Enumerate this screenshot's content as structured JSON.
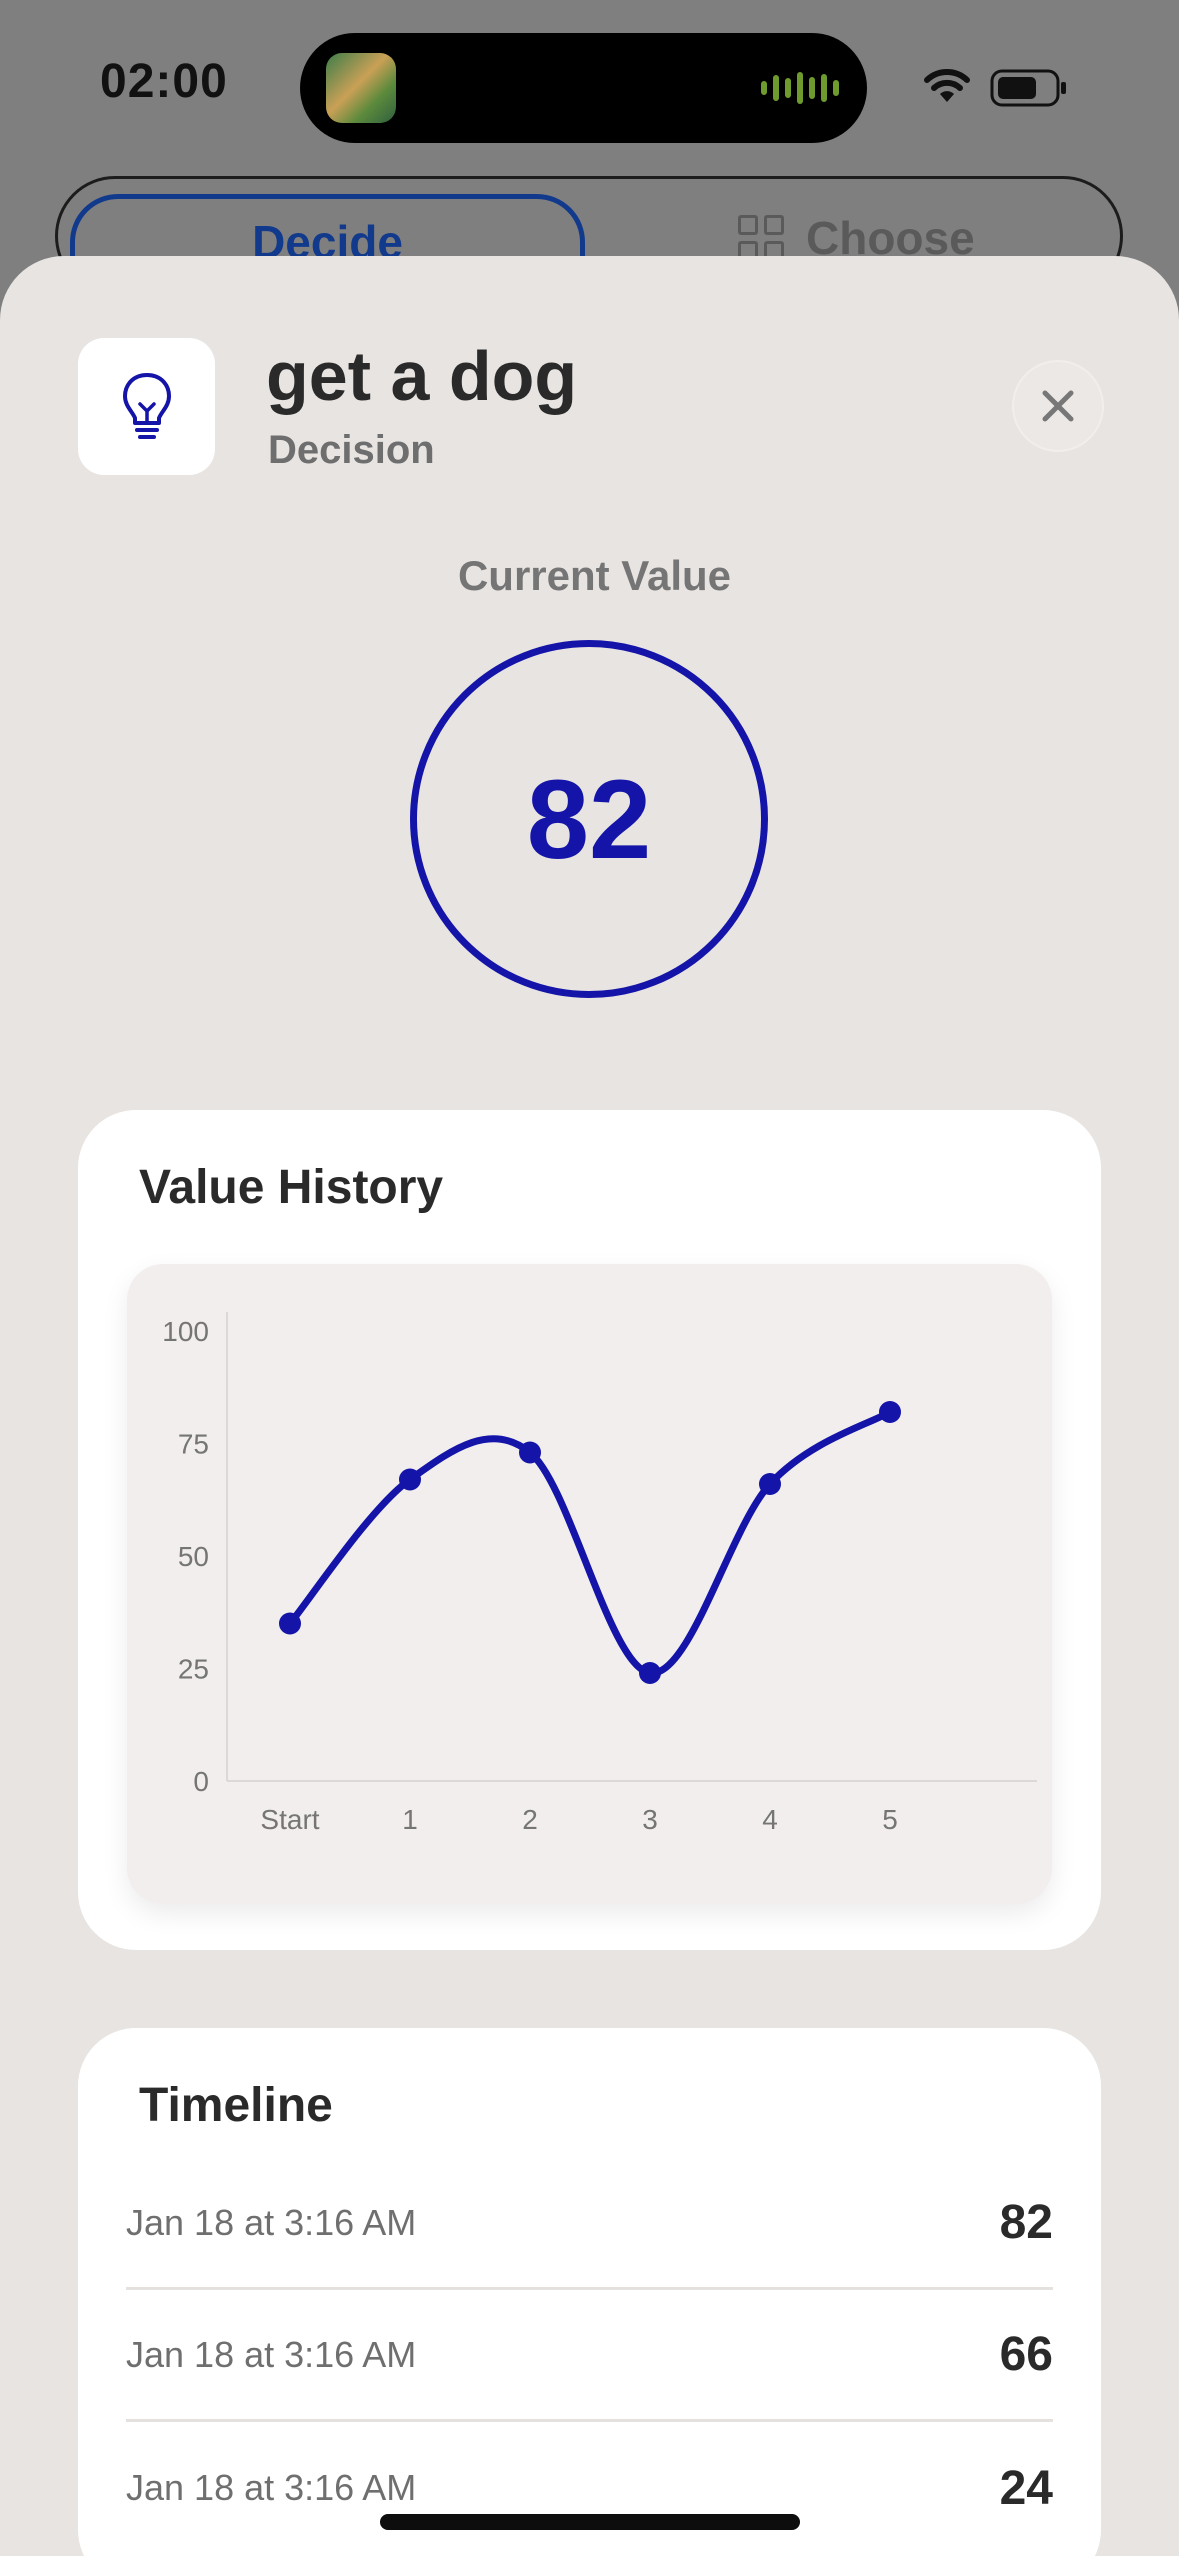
{
  "status_bar": {
    "time": "02:00",
    "wifi_icon": "wifi-icon",
    "battery_icon": "battery-icon",
    "now_playing_icon": "album-art-icon"
  },
  "background": {
    "segment_left_label": "Decide",
    "segment_right_label": "Choose"
  },
  "header": {
    "icon": "lightbulb-icon",
    "title": "get a dog",
    "subtitle": "Decision",
    "close_icon": "close-icon"
  },
  "current": {
    "label": "Current Value",
    "value": "82"
  },
  "history": {
    "title": "Value History"
  },
  "chart_data": {
    "type": "line",
    "categories": [
      "Start",
      "1",
      "2",
      "3",
      "4",
      "5"
    ],
    "series": [
      {
        "values": [
          35,
          67,
          73,
          24,
          66,
          82
        ]
      }
    ],
    "yticks": [
      "0",
      "25",
      "50",
      "75",
      "100"
    ],
    "ylim": [
      0,
      100
    ],
    "title": "",
    "xlabel": "",
    "ylabel": "",
    "color": "#1414a8",
    "grid": false
  },
  "timeline": {
    "title": "Timeline",
    "entries": [
      {
        "date": "Jan 18 at 3:16 AM",
        "value": "82"
      },
      {
        "date": "Jan 18 at 3:16 AM",
        "value": "66"
      },
      {
        "date": "Jan 18 at 3:16 AM",
        "value": "24"
      }
    ]
  },
  "colors": {
    "accent": "#1414a8",
    "sheet_background": "#e8e4e2",
    "card_background": "#ffffff"
  }
}
